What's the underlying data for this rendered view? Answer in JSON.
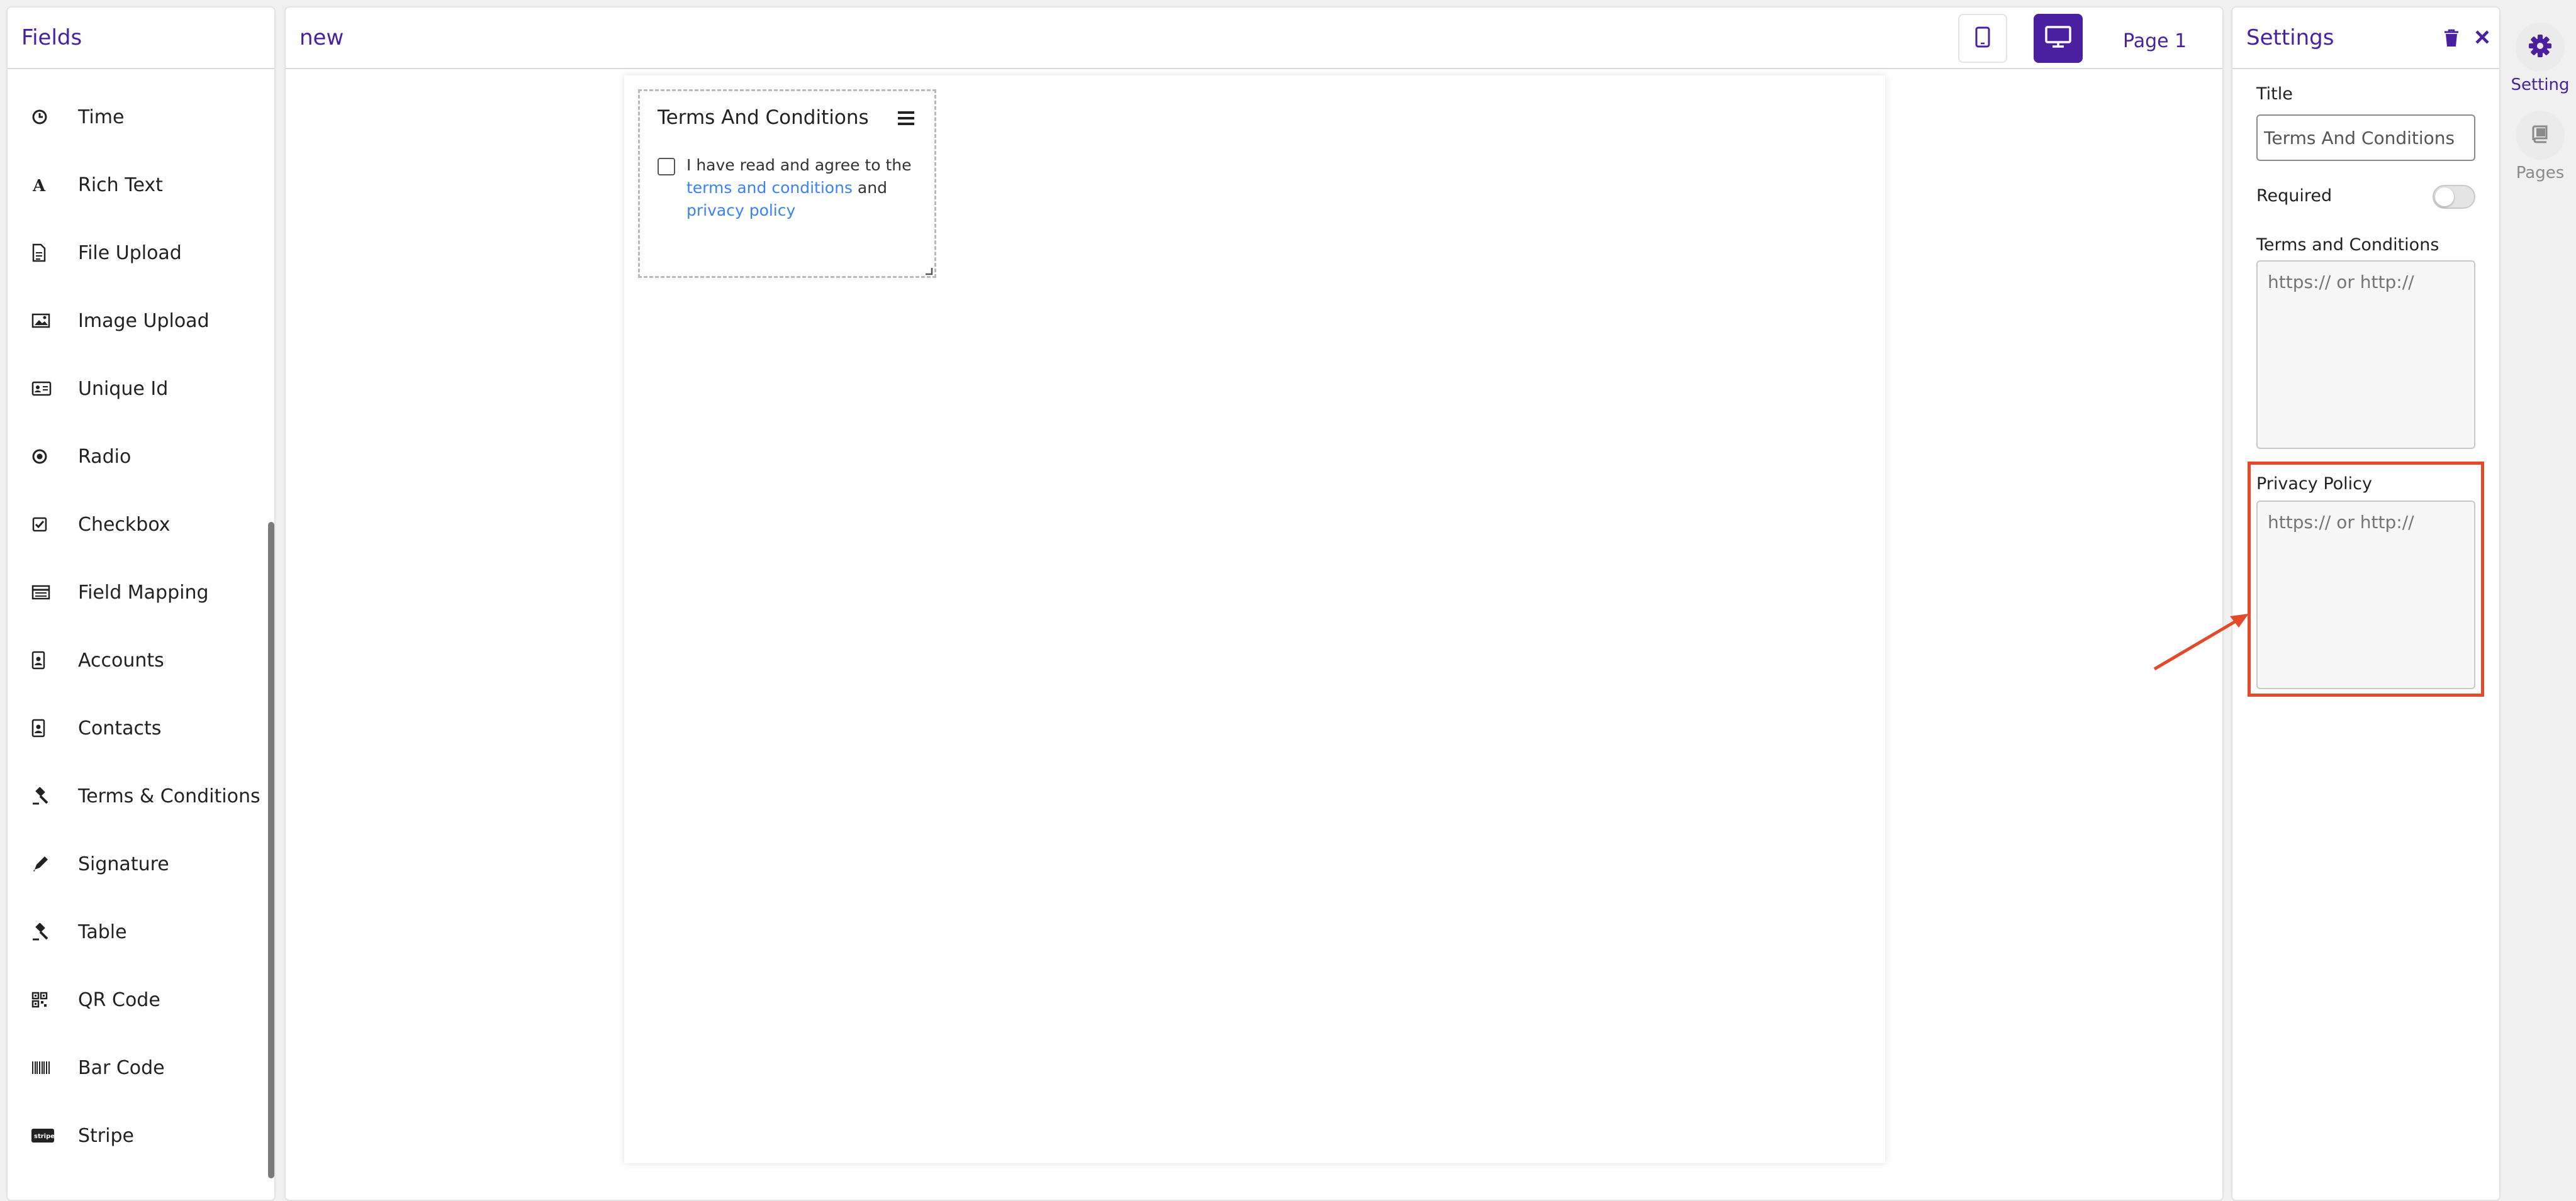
{
  "colors": {
    "accent": "#4a1fa0",
    "link": "#3b82f6",
    "highlight": "#e34a2c"
  },
  "fields_panel": {
    "title": "Fields",
    "items": [
      {
        "label": "Time",
        "icon": "clock-icon"
      },
      {
        "label": "Rich Text",
        "icon": "font-a-icon"
      },
      {
        "label": "File Upload",
        "icon": "file-icon"
      },
      {
        "label": "Image Upload",
        "icon": "image-icon"
      },
      {
        "label": "Unique Id",
        "icon": "id-card-icon"
      },
      {
        "label": "Radio",
        "icon": "radio-icon"
      },
      {
        "label": "Checkbox",
        "icon": "checkbox-icon"
      },
      {
        "label": "Field Mapping",
        "icon": "mapping-icon"
      },
      {
        "label": "Accounts",
        "icon": "contact-badge-icon"
      },
      {
        "label": "Contacts",
        "icon": "contact-badge-icon"
      },
      {
        "label": "Terms & Conditions",
        "icon": "gavel-icon"
      },
      {
        "label": "Signature",
        "icon": "pen-icon"
      },
      {
        "label": "Table",
        "icon": "gavel-icon"
      },
      {
        "label": "QR Code",
        "icon": "qr-code-icon"
      },
      {
        "label": "Bar Code",
        "icon": "barcode-icon"
      },
      {
        "label": "Stripe",
        "icon": "stripe-icon"
      }
    ]
  },
  "canvas": {
    "form_name": "new",
    "page_label": "Page 1",
    "widget": {
      "title": "Terms And Conditions",
      "text_prefix": "I have read and agree to the",
      "terms_link": "terms and conditions",
      "text_and": "and",
      "privacy_link": "privacy policy"
    }
  },
  "settings_panel": {
    "title": "Settings",
    "title_label": "Title",
    "title_value": "Terms And Conditions",
    "required_label": "Required",
    "required_value": false,
    "terms_label": "Terms and Conditions",
    "terms_placeholder": "https:// or http://",
    "privacy_label": "Privacy Policy",
    "privacy_placeholder": "https:// or http://"
  },
  "right_rail": {
    "setting_label": "Setting",
    "pages_label": "Pages"
  }
}
